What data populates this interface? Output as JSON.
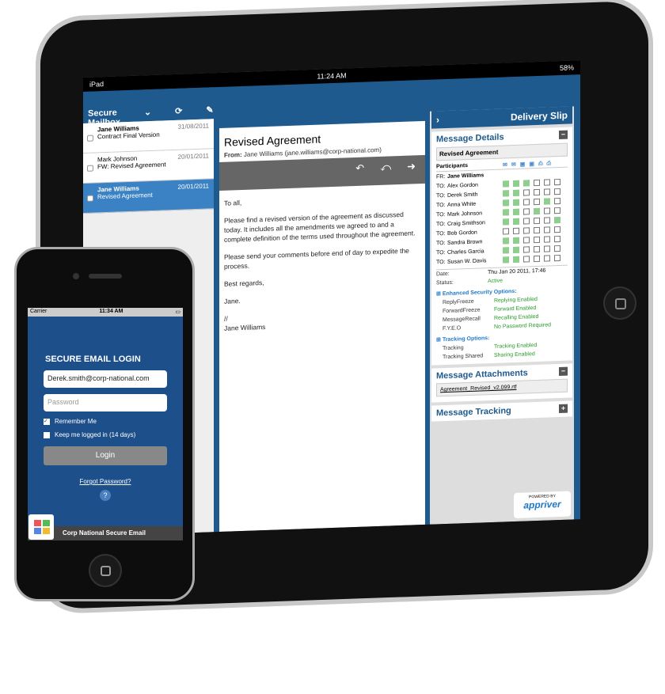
{
  "ipad": {
    "carrier": "iPad",
    "time": "11:24 AM",
    "battery": "58%"
  },
  "mailbox": {
    "title": "Secure Mailbox",
    "messages": [
      {
        "sender": "Jane Williams",
        "subject": "Contract Final Version",
        "date": "31/08/2011",
        "selected": false
      },
      {
        "sender": "Mark Johnson",
        "subject": "FW: Revised Agreement",
        "date": "20/01/2011",
        "selected": false
      },
      {
        "sender": "Jane Williams",
        "subject": "Revised Agreement",
        "date": "20/01/2011",
        "selected": true
      }
    ]
  },
  "message": {
    "title": "Revised Agreement",
    "from_label": "From:",
    "from": "Jane Williams (jane.williams@corp-national.com)",
    "body": [
      "To all,",
      "Please find a revised version of the agreement as discussed today. It includes all the amendments we agreed to and a complete definition of the terms used throughout the agreement.",
      "Please send your comments before end of day to expedite the process.",
      "Best regards,",
      "Jane.",
      "//\nJane Williams"
    ]
  },
  "delivery": {
    "title": "Delivery Slip",
    "details_title": "Message Details",
    "subject": "Revised Agreement",
    "participants_label": "Participants",
    "from": {
      "role": "FR:",
      "name": "Jane Williams"
    },
    "recipients": [
      {
        "role": "TO:",
        "name": "Alex Gordon",
        "status": [
          1,
          1,
          1,
          0,
          0,
          0
        ]
      },
      {
        "role": "TO:",
        "name": "Derek Smith",
        "status": [
          1,
          1,
          0,
          0,
          0,
          0
        ]
      },
      {
        "role": "TO:",
        "name": "Anna White",
        "status": [
          1,
          1,
          0,
          0,
          1,
          0
        ]
      },
      {
        "role": "TO:",
        "name": "Mark Johnson",
        "status": [
          1,
          1,
          0,
          1,
          0,
          0
        ]
      },
      {
        "role": "TO:",
        "name": "Craig Smithson",
        "status": [
          1,
          1,
          0,
          0,
          0,
          1
        ]
      },
      {
        "role": "TO:",
        "name": "Bob Gordon",
        "status": [
          0,
          0,
          0,
          0,
          0,
          0
        ]
      },
      {
        "role": "TO:",
        "name": "Sandra Brown",
        "status": [
          1,
          1,
          0,
          0,
          0,
          0
        ]
      },
      {
        "role": "TO:",
        "name": "Charles Garcia",
        "status": [
          1,
          1,
          0,
          0,
          0,
          0
        ]
      },
      {
        "role": "TO:",
        "name": "Susan W. Davis",
        "status": [
          1,
          1,
          0,
          0,
          0,
          0
        ]
      }
    ],
    "date_label": "Date:",
    "date": "Thu Jan 20 2011, 17:46",
    "status_label": "Status:",
    "status": "Active",
    "security_title": "Enhanced Security Options:",
    "security": [
      {
        "k": "ReplyFreeze",
        "v": "Replying Enabled"
      },
      {
        "k": "ForwardFreeze",
        "v": "Forward Enabled"
      },
      {
        "k": "MessageRecall",
        "v": "Recalling Enabled"
      },
      {
        "k": "F.Y.E.O",
        "v": "No Password Required"
      }
    ],
    "tracking_title": "Tracking Options:",
    "tracking": [
      {
        "k": "Tracking",
        "v": "Tracking Enabled"
      },
      {
        "k": "Tracking Shared",
        "v": "Sharing Enabled"
      }
    ],
    "attachments_title": "Message Attachments",
    "attachment": "Agreement_Revised_v2.099.rtf",
    "msg_tracking_title": "Message Tracking",
    "powered": "POWERED BY",
    "brand": "appriver"
  },
  "phone": {
    "carrier": "Carrier",
    "time": "11:34 AM",
    "title": "SECURE EMAIL LOGIN",
    "email": "Derek.smith@corp-national.com",
    "password_placeholder": "Password",
    "remember": "Remember Me",
    "keep": "Keep me logged in (14 days)",
    "login": "Login",
    "forgot": "Forgot Password?",
    "help": "?",
    "footer": "Corp National Secure Email"
  },
  "colors": {
    "primary": "#1e5a8e",
    "selected": "#3b82c4",
    "enabled": "#2a9a2a",
    "checked": "#8fce8f"
  }
}
